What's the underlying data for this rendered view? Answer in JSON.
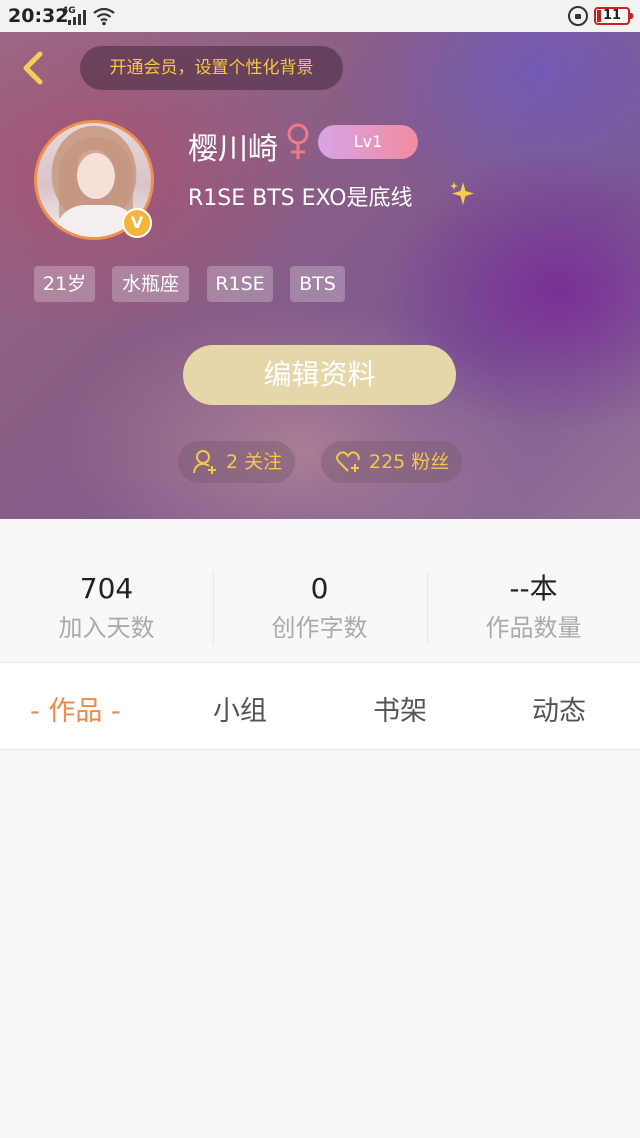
{
  "status_bar": {
    "time": "20:32",
    "network": "4G",
    "battery": "11"
  },
  "header": {
    "vip_promo": "开通会员，设置个性化背景"
  },
  "profile": {
    "username": "樱川崎",
    "level": "Lv1",
    "bio": "R1SE   BTS    EXO是底线",
    "tags": [
      "21岁",
      "水瓶座",
      "R1SE",
      "BTS"
    ],
    "edit_button": "编辑资料",
    "following": "2 关注",
    "followers": "225 粉丝"
  },
  "stats": [
    {
      "value": "704",
      "label": "加入天数"
    },
    {
      "value": "0",
      "label": "创作字数"
    },
    {
      "value": "--本",
      "label": "作品数量"
    }
  ],
  "tabs": [
    {
      "label": "- 作品 -",
      "active": true
    },
    {
      "label": "小组",
      "active": false
    },
    {
      "label": "书架",
      "active": false
    },
    {
      "label": "动态",
      "active": false
    }
  ],
  "colors": {
    "accent_orange": "#f08a4b",
    "gold_text": "#f5c84a",
    "edit_button_bg": "#e5d7aa",
    "level_badge": "#e89ab8",
    "female_icon": "#f07a86"
  },
  "icons": {
    "back": "chevron-left-icon",
    "female": "female-symbol-icon",
    "sparkle": "sparkle-icon",
    "verified": "v-badge-icon",
    "following": "person-add-icon",
    "followers": "heart-add-icon"
  }
}
